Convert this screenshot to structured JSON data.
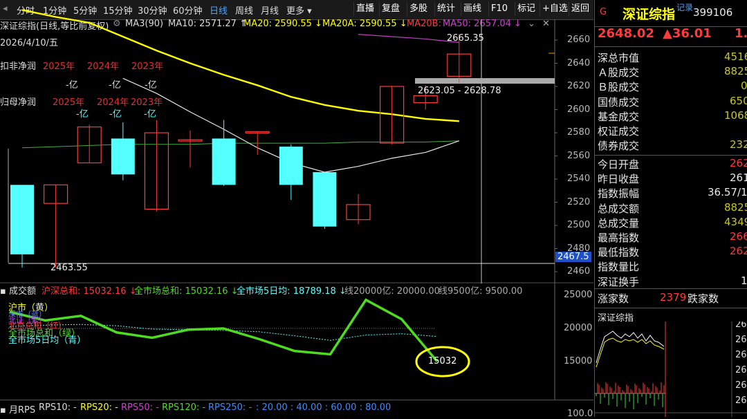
{
  "toolbar": {
    "periods": [
      "分时",
      "1分钟",
      "5分钟",
      "15分钟",
      "30分钟",
      "60分钟",
      "日线",
      "周线",
      "月线",
      "更多"
    ],
    "active_period": "日线",
    "more_arrow": "▾",
    "buttons": [
      "直播",
      "复盘",
      "多股",
      "统计",
      "画线",
      "F10",
      "标记",
      "+自选",
      "返回"
    ]
  },
  "chart_info": {
    "index_name": "深证综指(日线,等比前复权)",
    "ma3": "MA3(90)",
    "ma10": "MA10: 2571.27 ↑",
    "ma20": "MA20: 2590.55 ↓",
    "ma20a": "MA20A: 2590.55 ↓",
    "ma20b": "MA20B:",
    "ma50": "MA50: 2657.04 ↓",
    "date": "2026/4/10/五",
    "high_label": "2665.35",
    "low_label": "2463.55",
    "range_label": "2623.05 - 2628.78",
    "crosshair_value": "2467.5",
    "net_profit_label": "扣非净润",
    "parent_profit_label": "归母净润",
    "years": [
      "2025年",
      "2024年",
      "2023年"
    ],
    "yi_values": [
      "-亿",
      "-亿",
      "-亿"
    ]
  },
  "price_axis": [
    "2660",
    "2640",
    "2620",
    "2600",
    "2580",
    "2560",
    "2540",
    "2520",
    "2500",
    "2480",
    "2460"
  ],
  "chart_data": {
    "type": "candlestick",
    "candles": [
      {
        "o": 2535,
        "c": 2475,
        "h": 2535,
        "l": 2463.55
      },
      {
        "o": 2519,
        "c": 2535,
        "h": 2535,
        "l": 2463.55
      },
      {
        "o": 2554,
        "c": 2585,
        "h": 2587,
        "l": 2554
      },
      {
        "o": 2575,
        "c": 2544,
        "h": 2589,
        "l": 2539
      },
      {
        "o": 2514,
        "c": 2580,
        "h": 2591,
        "l": 2512
      },
      {
        "o": 2574,
        "c": 2574,
        "h": 2582,
        "l": 2550
      },
      {
        "o": 2575,
        "c": 2535,
        "h": 2591,
        "l": 2534
      },
      {
        "o": 2580,
        "c": 2581,
        "h": 2581,
        "l": 2561
      },
      {
        "o": 2568,
        "c": 2535,
        "h": 2570,
        "l": 2522
      },
      {
        "o": 2546,
        "c": 2499,
        "h": 2546,
        "l": 2497
      },
      {
        "o": 2505,
        "c": 2518,
        "h": 2527,
        "l": 2501
      },
      {
        "o": 2571,
        "c": 2620,
        "h": 2620,
        "l": 2570
      },
      {
        "o": 2606,
        "c": 2612,
        "h": 2621,
        "l": 2600
      },
      {
        "o": 2628.78,
        "c": 2648,
        "h": 2665.35,
        "l": 2623.05
      }
    ],
    "ma_white": [
      null,
      null,
      null,
      2627,
      2614,
      2598,
      2583,
      2567,
      2554,
      2546,
      2551,
      2558,
      2563,
      2573
    ],
    "ma_yellow": [
      2686,
      2680,
      2675,
      2663,
      2651,
      2640,
      2630,
      2621,
      2611,
      2604,
      2599,
      2596,
      2592,
      2590
    ],
    "ma_green": [
      2567,
      2568,
      2569,
      2570,
      2570,
      2570,
      2571,
      2571,
      2571,
      2571,
      2572,
      2572,
      2572,
      2573
    ],
    "ma_purple": [
      null,
      null,
      null,
      null,
      null,
      null,
      null,
      null,
      null,
      null,
      2665,
      2663,
      2661,
      2658
    ]
  },
  "volume_info": {
    "title": "成交额",
    "sh_sz": "沪深总和: 15032.16 ↓",
    "market": "全市场总和: 15032.16 ↓",
    "market5": "全市场5日均: 18789.18 ↓",
    "line20000": "线20000亿: 20000.00",
    "line9500": "线9500亿: 9500.00",
    "legend_sh": "沪市（黄）",
    "legend_a": "深市（蓝）",
    "legend_b": "北证（紫）",
    "legend_c": "北京总和（红）",
    "legend_all": "全市场总和（绿）",
    "legend_5d": "全市场5日均（青）",
    "callout": "15032"
  },
  "volume_axis": [
    "25000",
    "20000",
    "15000"
  ],
  "volume_data": {
    "total": [
      22500,
      21200,
      21900,
      19400,
      18600,
      19800,
      20000,
      18400,
      16600,
      16100,
      24300,
      21400,
      15032
    ],
    "avg5": [
      20300,
      20500,
      20600,
      20400,
      19900,
      19800,
      19700,
      19500,
      18900,
      18200,
      19000,
      19200,
      18789
    ]
  },
  "rps_bar": {
    "label": "月RPS",
    "rps10": "RPS10: -",
    "rps20": "RPS20: -",
    "rps50": "RPS50: -",
    "rps120": "RPS120: -",
    "rps250": "RPS250: -",
    "levels": ": 20.00 : 40.00 : 60.00 : 80.00"
  },
  "rps_axis_bottom": "100.0",
  "quote": {
    "title": "深证综指",
    "code": "399106",
    "record": "记录",
    "price": "2648.02",
    "change": "▲36.01",
    "pct": "1.",
    "rows": [
      {
        "label": "深总市值",
        "value": "4516"
      },
      {
        "label": "Ａ股成交",
        "value": "8825"
      },
      {
        "label": "Ｂ股成交",
        "value": "0"
      },
      {
        "label": "国债成交",
        "value": "650"
      },
      {
        "label": "基金成交",
        "value": "1068"
      },
      {
        "label": "权证成交",
        "value": ""
      },
      {
        "label": "债券成交",
        "value": "232"
      }
    ],
    "rows2": [
      {
        "label": "今日开盘",
        "value": "262"
      },
      {
        "label": "昨日收盘",
        "value": "261"
      },
      {
        "label": "指数振幅",
        "value": "36.57/1"
      },
      {
        "label": "总成交额",
        "value": "8825"
      },
      {
        "label": "总成交量",
        "value": "4349"
      },
      {
        "label": "最高指数",
        "value": "266"
      },
      {
        "label": "最低指数",
        "value": "262"
      },
      {
        "label": "指数量比",
        "value": ""
      },
      {
        "label": "深证换手",
        "value": "1"
      }
    ],
    "up_label": "涨家数",
    "up_count": "2379",
    "down_label": "跌家数",
    "mini_title": "深证综指",
    "mini_axis": [
      "26",
      "26",
      "26",
      "26",
      "26",
      "26"
    ]
  },
  "colors": {
    "up": "#ff3a3a",
    "down": "#54ffff",
    "ma_white": "#e8e8e8",
    "ma_yellow": "#ffff00",
    "ma_green": "#3cb043",
    "ma_purple": "#c040c0",
    "vol_green": "#4ddc1e"
  }
}
